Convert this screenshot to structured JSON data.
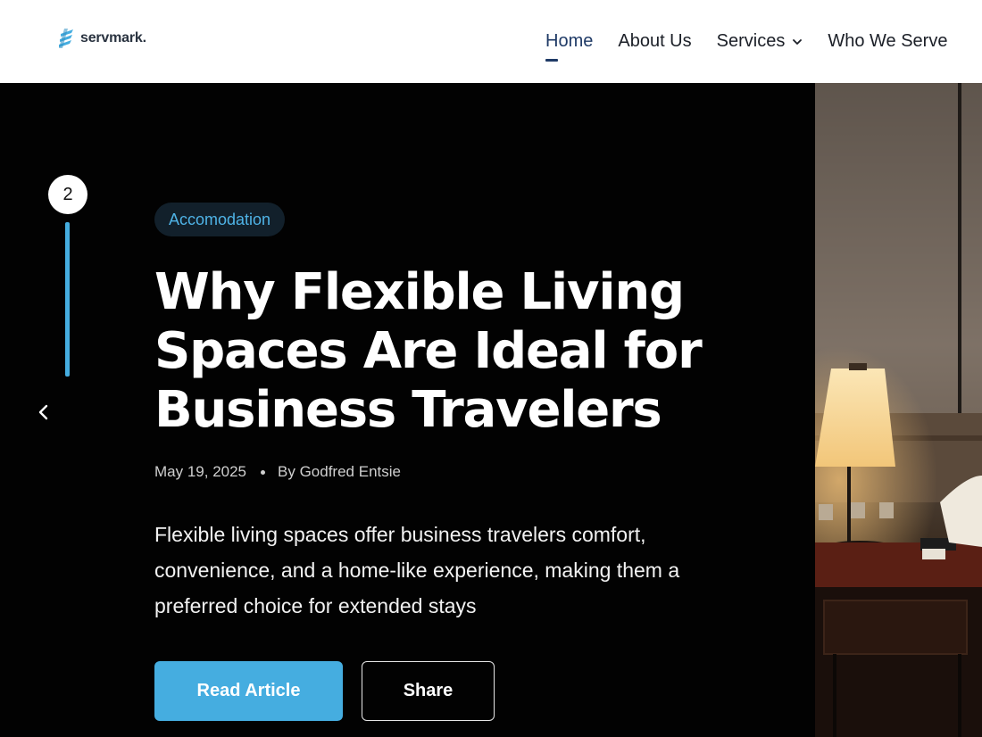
{
  "brand": {
    "name": "servmark."
  },
  "nav": {
    "items": [
      {
        "label": "Home",
        "active": true
      },
      {
        "label": "About Us"
      },
      {
        "label": "Services",
        "has_dropdown": true
      },
      {
        "label": "Who We Serve"
      }
    ]
  },
  "hero": {
    "slide_number": "2",
    "category": "Accomodation",
    "title": "Why Flexible Living Spaces Are Ideal for Business Travelers",
    "date": "May 19, 2025",
    "author": "By Godfred Entsie",
    "excerpt": "Flexible living spaces offer business travelers comfort, convenience, and a home-like experience, making them a preferred choice for extended stays",
    "primary_button": "Read Article",
    "secondary_button": "Share",
    "image": "hotel-room-lamp-bed"
  },
  "colors": {
    "accent": "#45ade0",
    "nav_active": "#1f3a66",
    "hero_bg": "#020202",
    "badge_bg": "#12202b"
  }
}
